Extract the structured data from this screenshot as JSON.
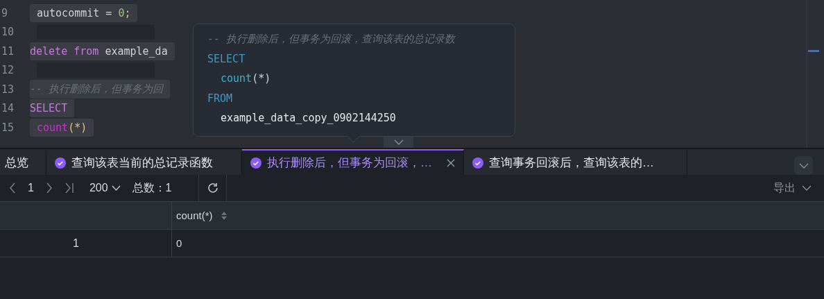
{
  "editor": {
    "lines": [
      {
        "number": "9",
        "indent": true,
        "tokens": [
          {
            "kind": "plain",
            "text": "autocommit ="
          },
          {
            "kind": "number",
            "text": "0"
          },
          {
            "kind": "paren",
            "text": ";"
          }
        ]
      },
      {
        "number": "10",
        "indent": true
      },
      {
        "number": "11",
        "indent": false,
        "tokens": [
          {
            "kind": "keyword",
            "text": "delete"
          },
          {
            "kind": "keyword",
            "text": "from"
          },
          {
            "kind": "plain",
            "text": "example_da"
          }
        ]
      },
      {
        "number": "12",
        "indent": true
      },
      {
        "number": "13",
        "indent": false,
        "tokens": [
          {
            "kind": "comment",
            "text": "-- 执行删除后，但事务为回"
          }
        ]
      },
      {
        "number": "14",
        "indent": false,
        "tokens": [
          {
            "kind": "keyword",
            "text": "SELECT"
          }
        ]
      },
      {
        "number": "15",
        "indent": true,
        "tokens": [
          {
            "kind": "function",
            "text": "count"
          },
          {
            "kind": "paren",
            "text": "(*)"
          }
        ]
      }
    ]
  },
  "tooltip": {
    "lines": [
      {
        "indent": false,
        "tokens": [
          {
            "kind": "comment",
            "text": "-- 执行删除后，但事务为回滚，查询该表的总记录数"
          }
        ]
      },
      {
        "indent": false,
        "tokens": [
          {
            "kind": "keyword",
            "text": "SELECT"
          }
        ]
      },
      {
        "indent": true,
        "tokens": [
          {
            "kind": "function",
            "text": "count"
          },
          {
            "kind": "paren",
            "text": "(*)"
          }
        ]
      },
      {
        "indent": false,
        "tokens": [
          {
            "kind": "keyword",
            "text": "FROM"
          }
        ]
      },
      {
        "indent": true,
        "tokens": [
          {
            "kind": "plain",
            "text": "example_data_copy_0902144250"
          }
        ]
      }
    ]
  },
  "result_tabs": [
    {
      "label": "总览",
      "selected": false,
      "status": false,
      "closable": false
    },
    {
      "label": "查询该表当前的总记录函数",
      "selected": false,
      "status": true,
      "closable": false
    },
    {
      "label": "执行删除后，但事务为回滚，…",
      "selected": true,
      "status": true,
      "closable": true
    },
    {
      "label": "查询事务回滚后，查询该表的…",
      "selected": false,
      "status": true,
      "closable": false
    }
  ],
  "toolbar": {
    "page": "1",
    "page_size": "200",
    "total_label": "总数：",
    "total": "1",
    "export": "导出"
  },
  "table": {
    "columns": [
      {},
      {
        "label": "count(*)"
      }
    ],
    "rows": [
      {
        "index": "1",
        "cells": [
          "0"
        ]
      }
    ]
  }
}
